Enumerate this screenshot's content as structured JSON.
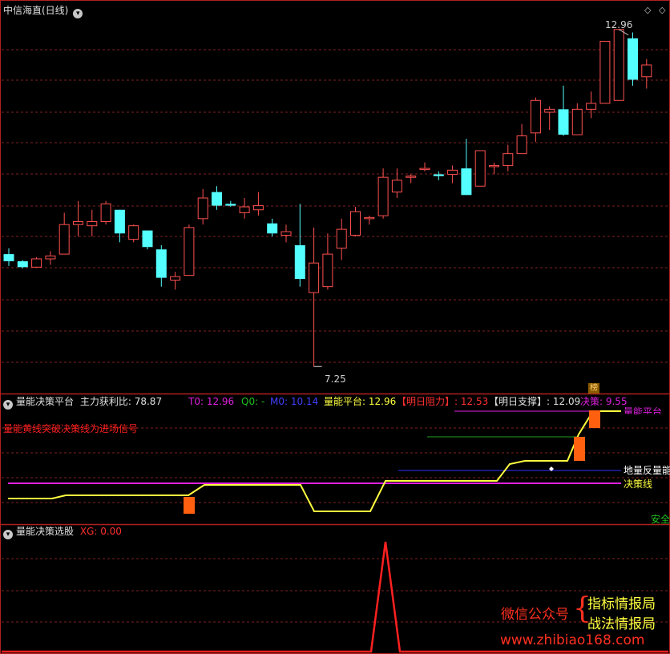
{
  "colors": {
    "up": "#ff5050",
    "down": "#54ffff",
    "grid": "#802020",
    "border": "#b02020",
    "yellow": "#ffff40",
    "magenta": "#e020e0",
    "green": "#20a020",
    "blue": "#3030ff",
    "orange": "#ff6010",
    "red_line": "#ff2020"
  },
  "main_panel": {
    "title": "中信海直(日线)",
    "collapse_icon": "chevron-down-icon",
    "high_marker": "12.96",
    "low_marker": "7.25",
    "badge": "榜",
    "settings_icons": [
      "diamond-icon",
      "diamond-icon"
    ]
  },
  "indicator1": {
    "name": "量能决策平台",
    "ratio_label": "主力获利比:",
    "ratio_value": "78.87",
    "t0": "T0: 12.96",
    "q0": "Q0: -",
    "m0": "M0: 10.14",
    "platform": "量能平台: 12.96",
    "resistance": "【明日阻力】: 12.53",
    "support": "【明日支撑】: 12.09",
    "decision": "决策: 9.55",
    "note": "量能黄线突破决策线为进场信号",
    "line_label_decision": "决策线",
    "line_label_ground": "地量反量能",
    "line_label_platform": "量能平台",
    "line_label_safe": "安全"
  },
  "indicator2": {
    "name": "量能决策选股",
    "xg": "XG: 0.00"
  },
  "watermark": {
    "wechat": "微信公众号",
    "brace": "{",
    "name1": "指标情报局",
    "name2": "战法情报局",
    "url": "www.zhibiao168.com"
  },
  "chart_data": [
    {
      "type": "candlestick",
      "title": "中信海直(日线)",
      "ylim": [
        7.0,
        13.1
      ],
      "columns": [
        "open",
        "high",
        "low",
        "close"
      ],
      "candles": [
        [
          9.1,
          9.2,
          8.9,
          8.98
        ],
        [
          8.98,
          9.0,
          8.86,
          8.88
        ],
        [
          8.88,
          9.05,
          8.88,
          9.02
        ],
        [
          9.02,
          9.15,
          8.92,
          9.07
        ],
        [
          9.1,
          9.8,
          9.1,
          9.6
        ],
        [
          9.6,
          10.0,
          9.4,
          9.65
        ],
        [
          9.58,
          9.85,
          9.4,
          9.65
        ],
        [
          9.65,
          10.0,
          9.6,
          9.95
        ],
        [
          9.85,
          9.85,
          9.3,
          9.45
        ],
        [
          9.35,
          9.6,
          9.3,
          9.58
        ],
        [
          9.5,
          9.5,
          9.18,
          9.22
        ],
        [
          9.18,
          9.25,
          8.55,
          8.7
        ],
        [
          8.66,
          8.8,
          8.5,
          8.72
        ],
        [
          8.74,
          9.6,
          8.74,
          9.55
        ],
        [
          9.7,
          10.2,
          9.6,
          10.05
        ],
        [
          10.15,
          10.25,
          9.85,
          9.92
        ],
        [
          9.95,
          10.0,
          9.9,
          9.92
        ],
        [
          9.8,
          10.05,
          9.7,
          9.9
        ],
        [
          9.85,
          10.15,
          9.75,
          9.92
        ],
        [
          9.62,
          9.7,
          9.4,
          9.45
        ],
        [
          9.42,
          9.6,
          9.3,
          9.48
        ],
        [
          9.25,
          9.95,
          8.55,
          8.68
        ],
        [
          8.45,
          9.55,
          7.2,
          8.95
        ],
        [
          8.55,
          9.45,
          8.5,
          9.1
        ],
        [
          9.2,
          9.7,
          9.0,
          9.52
        ],
        [
          9.42,
          9.9,
          9.4,
          9.82
        ],
        [
          9.7,
          9.75,
          9.6,
          9.72
        ],
        [
          9.75,
          10.55,
          9.7,
          10.4
        ],
        [
          10.15,
          10.55,
          10.05,
          10.35
        ],
        [
          10.4,
          10.45,
          10.3,
          10.42
        ],
        [
          10.55,
          10.65,
          10.5,
          10.55
        ],
        [
          10.45,
          10.5,
          10.35,
          10.42
        ],
        [
          10.45,
          10.6,
          10.3,
          10.52
        ],
        [
          10.55,
          11.05,
          10.1,
          10.1
        ],
        [
          10.25,
          10.85,
          10.25,
          10.85
        ],
        [
          10.6,
          10.65,
          10.45,
          10.6
        ],
        [
          10.6,
          10.95,
          10.5,
          10.8
        ],
        [
          10.8,
          11.3,
          10.8,
          11.1
        ],
        [
          11.15,
          11.75,
          11.0,
          11.7
        ],
        [
          11.5,
          11.6,
          11.2,
          11.55
        ],
        [
          11.55,
          11.95,
          11.1,
          11.12
        ],
        [
          11.12,
          11.65,
          11.12,
          11.55
        ],
        [
          11.55,
          11.85,
          11.4,
          11.65
        ],
        [
          11.65,
          12.7,
          11.65,
          12.7
        ],
        [
          11.7,
          12.9,
          11.7,
          12.9
        ],
        [
          12.75,
          12.85,
          11.95,
          12.05
        ],
        [
          12.1,
          12.4,
          11.9,
          12.3
        ]
      ]
    },
    {
      "type": "line",
      "title": "量能决策平台",
      "series": [
        {
          "name": "决策线",
          "values": [
            9.55
          ]
        }
      ]
    },
    {
      "type": "line",
      "title": "量能决策选股",
      "series": [
        {
          "name": "XG",
          "values": [
            0.0
          ]
        }
      ]
    }
  ]
}
